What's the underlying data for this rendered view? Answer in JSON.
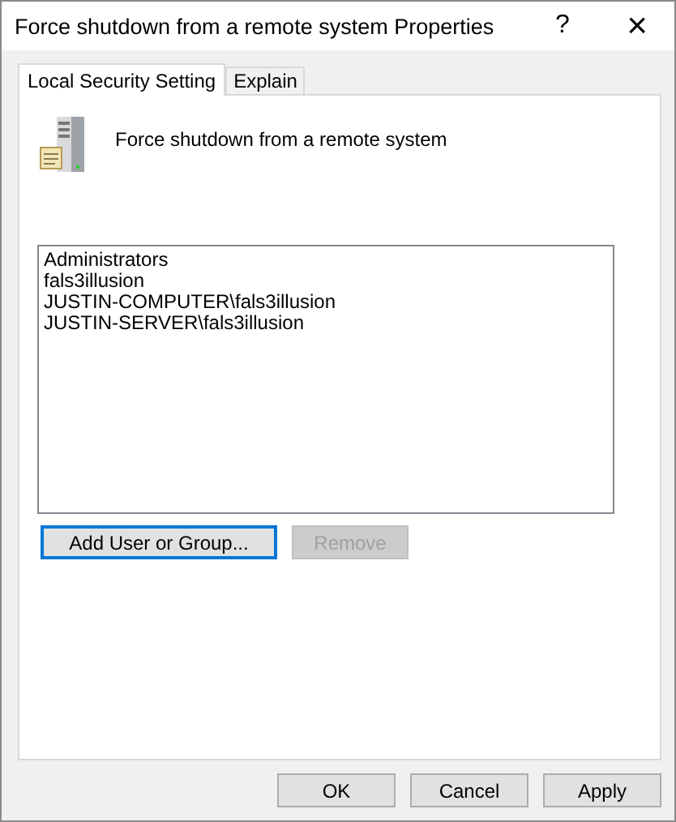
{
  "window": {
    "title": "Force shutdown from a remote system Properties",
    "help_glyph": "?",
    "close_glyph": "×"
  },
  "tabs": [
    {
      "label": "Local Security Setting",
      "selected": true
    },
    {
      "label": "Explain",
      "selected": false
    }
  ],
  "policy": {
    "name": "Force shutdown from a remote system"
  },
  "accounts": [
    "Administrators",
    "fals3illusion",
    "JUSTIN-COMPUTER\\fals3illusion",
    "JUSTIN-SERVER\\fals3illusion"
  ],
  "list_buttons": [
    {
      "label": "Add User or Group...",
      "disabled": false,
      "focused": true
    },
    {
      "label": "Remove",
      "disabled": true,
      "focused": false
    }
  ],
  "buttons": [
    {
      "label": "OK",
      "disabled": false
    },
    {
      "label": "Cancel",
      "disabled": false
    },
    {
      "label": "Apply",
      "disabled": false
    }
  ]
}
